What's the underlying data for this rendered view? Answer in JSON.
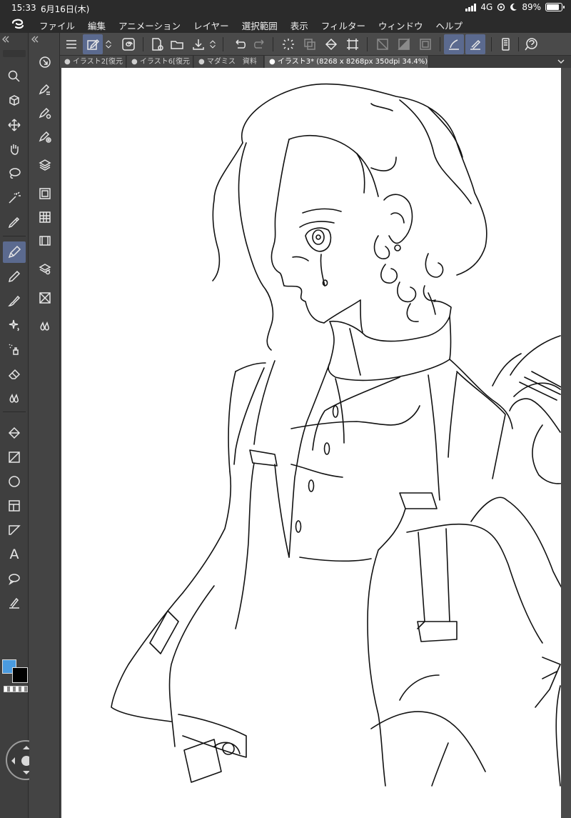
{
  "status": {
    "time": "15:33",
    "date": "6月16日(木)",
    "network": "4G",
    "battery": "89%",
    "battery_level": 0.89
  },
  "menu": {
    "items": [
      "ファイル",
      "編集",
      "アニメーション",
      "レイヤー",
      "選択範囲",
      "表示",
      "フィルター",
      "ウィンドウ",
      "ヘルプ"
    ]
  },
  "tabs": [
    {
      "label": "● イラスト2[復元",
      "active": false
    },
    {
      "label": "● イラスト6[復元",
      "active": false
    },
    {
      "label": "● マダミス　資料",
      "active": false
    },
    {
      "label": "● イラスト3* (8268 x 8268px 350dpi 34.4%)",
      "active": true
    }
  ],
  "colors": {
    "main": "#4a9be0",
    "sub": "#000000",
    "accent_selected": "#5b6a8f"
  },
  "icons": {
    "command_bar": [
      "menu-icon",
      "edit-icon",
      "chevron-updown-icon",
      "spiral-icon",
      "new-canvas-icon",
      "open-folder-icon",
      "save-icon",
      "chevron-updown-icon",
      "undo-icon",
      "redo-icon",
      "loading-icon",
      "copy-layer-icon",
      "fill-icon",
      "transform-icon",
      "clear-icon",
      "fill-selection-icon",
      "select-all-icon",
      "pen-pressure-icon",
      "ruler-snap-icon",
      "device-icon",
      "help-icon"
    ],
    "tools": [
      "zoom-icon",
      "object-select-icon",
      "move-icon",
      "hand-icon",
      "lasso-icon",
      "magic-wand-icon",
      "eyedropper-icon",
      "pen-icon",
      "pencil-icon",
      "brush-icon",
      "sparkle-icon",
      "airbrush-icon",
      "eraser-icon",
      "blend-icon",
      "fill-bucket-icon",
      "gradient-icon",
      "shape-icon",
      "frame-icon",
      "ruler-icon",
      "text-icon",
      "balloon-icon",
      "line-correction-icon"
    ],
    "subtools": [
      "navigator-icon",
      "tool-property-icon",
      "brush-size-icon",
      "sub-tool-detail-icon",
      "layer-icon",
      "layer-property-icon",
      "color-set-icon",
      "timeline-icon",
      "layer-search-icon",
      "material-icon",
      "droplet-icon"
    ]
  }
}
